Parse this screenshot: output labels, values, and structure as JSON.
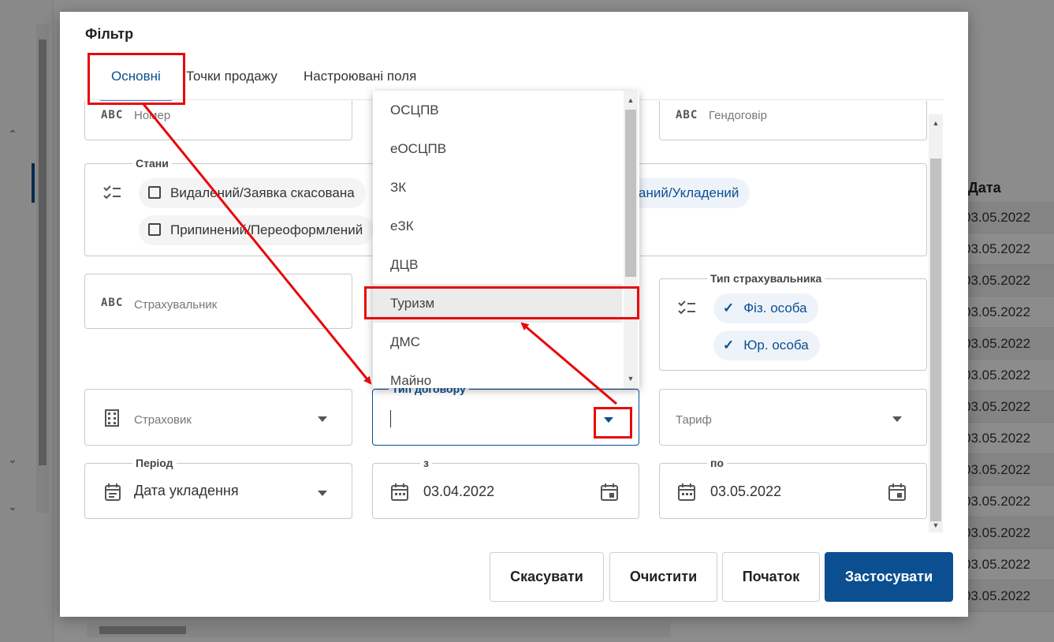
{
  "background": {
    "date_header": "Дата",
    "dates": [
      "03.05.2022",
      "03.05.2022",
      "03.05.2022",
      "03.05.2022",
      "03.05.2022",
      "03.05.2022",
      "03.05.2022",
      "03.05.2022",
      "03.05.2022",
      "03.05.2022",
      "03.05.2022",
      "03.05.2022",
      "03.05.2022"
    ]
  },
  "dialog": {
    "title": "Фільтр",
    "tabs": [
      {
        "label": "Основні",
        "active": true
      },
      {
        "label": "Точки продажу",
        "active": false
      },
      {
        "label": "Настроювані поля",
        "active": false
      }
    ],
    "fields": {
      "number": {
        "placeholder": "Номер",
        "icon": "abc-icon"
      },
      "gendohovir": {
        "placeholder": "Гендоговір",
        "icon": "abc-icon"
      },
      "states": {
        "legend": "Стани",
        "chips": [
          {
            "label": "Видалений/Заявка скасована",
            "checked": false
          },
          {
            "label": "Припинений/Переоформлений",
            "checked": false
          }
        ],
        "partial_chip": "аний/Укладений"
      },
      "insurer_person": {
        "placeholder": "Страхувальник",
        "icon": "abc-icon"
      },
      "insurer_type": {
        "legend": "Тип страхувальника",
        "chips": [
          {
            "label": "Фіз. особа",
            "checked": true
          },
          {
            "label": "Юр. особа",
            "checked": true
          }
        ]
      },
      "insurer_company": {
        "placeholder": "Страховик",
        "icon": "building-icon"
      },
      "contract_type": {
        "legend": "Тип договору",
        "value": ""
      },
      "tariff": {
        "placeholder": "Тариф"
      },
      "period": {
        "legend": "Період",
        "value": "Дата укладення"
      },
      "from": {
        "legend": "з",
        "value": "03.04.2022"
      },
      "to": {
        "legend": "по",
        "value": "03.05.2022"
      }
    },
    "dropdown": {
      "options": [
        "ОСЦПВ",
        "еОСЦПВ",
        "ЗК",
        "еЗК",
        "ДЦВ",
        "Туризм",
        "ДМС",
        "Майно"
      ],
      "highlighted": "Туризм"
    },
    "buttons": {
      "cancel": "Скасувати",
      "clear": "Очистити",
      "reset": "Початок",
      "apply": "Застосувати"
    }
  },
  "colors": {
    "accent": "#0b4f91",
    "annotation": "#e8080a"
  }
}
